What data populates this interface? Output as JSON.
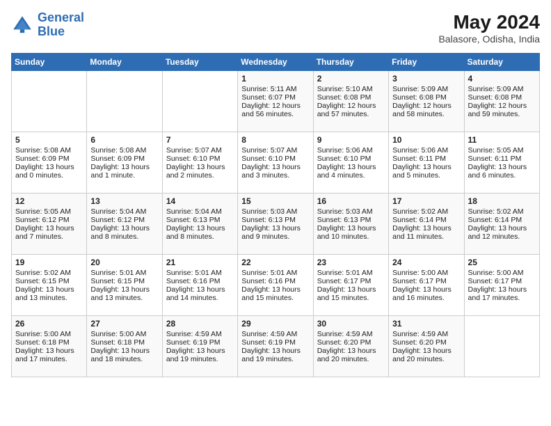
{
  "logo": {
    "line1": "General",
    "line2": "Blue"
  },
  "title": {
    "month_year": "May 2024",
    "location": "Balasore, Odisha, India"
  },
  "days_of_week": [
    "Sunday",
    "Monday",
    "Tuesday",
    "Wednesday",
    "Thursday",
    "Friday",
    "Saturday"
  ],
  "weeks": [
    [
      {
        "day": "",
        "sunrise": "",
        "sunset": "",
        "daylight": ""
      },
      {
        "day": "",
        "sunrise": "",
        "sunset": "",
        "daylight": ""
      },
      {
        "day": "",
        "sunrise": "",
        "sunset": "",
        "daylight": ""
      },
      {
        "day": "1",
        "sunrise": "Sunrise: 5:11 AM",
        "sunset": "Sunset: 6:07 PM",
        "daylight": "Daylight: 12 hours and 56 minutes."
      },
      {
        "day": "2",
        "sunrise": "Sunrise: 5:10 AM",
        "sunset": "Sunset: 6:08 PM",
        "daylight": "Daylight: 12 hours and 57 minutes."
      },
      {
        "day": "3",
        "sunrise": "Sunrise: 5:09 AM",
        "sunset": "Sunset: 6:08 PM",
        "daylight": "Daylight: 12 hours and 58 minutes."
      },
      {
        "day": "4",
        "sunrise": "Sunrise: 5:09 AM",
        "sunset": "Sunset: 6:08 PM",
        "daylight": "Daylight: 12 hours and 59 minutes."
      }
    ],
    [
      {
        "day": "5",
        "sunrise": "Sunrise: 5:08 AM",
        "sunset": "Sunset: 6:09 PM",
        "daylight": "Daylight: 13 hours and 0 minutes."
      },
      {
        "day": "6",
        "sunrise": "Sunrise: 5:08 AM",
        "sunset": "Sunset: 6:09 PM",
        "daylight": "Daylight: 13 hours and 1 minute."
      },
      {
        "day": "7",
        "sunrise": "Sunrise: 5:07 AM",
        "sunset": "Sunset: 6:10 PM",
        "daylight": "Daylight: 13 hours and 2 minutes."
      },
      {
        "day": "8",
        "sunrise": "Sunrise: 5:07 AM",
        "sunset": "Sunset: 6:10 PM",
        "daylight": "Daylight: 13 hours and 3 minutes."
      },
      {
        "day": "9",
        "sunrise": "Sunrise: 5:06 AM",
        "sunset": "Sunset: 6:10 PM",
        "daylight": "Daylight: 13 hours and 4 minutes."
      },
      {
        "day": "10",
        "sunrise": "Sunrise: 5:06 AM",
        "sunset": "Sunset: 6:11 PM",
        "daylight": "Daylight: 13 hours and 5 minutes."
      },
      {
        "day": "11",
        "sunrise": "Sunrise: 5:05 AM",
        "sunset": "Sunset: 6:11 PM",
        "daylight": "Daylight: 13 hours and 6 minutes."
      }
    ],
    [
      {
        "day": "12",
        "sunrise": "Sunrise: 5:05 AM",
        "sunset": "Sunset: 6:12 PM",
        "daylight": "Daylight: 13 hours and 7 minutes."
      },
      {
        "day": "13",
        "sunrise": "Sunrise: 5:04 AM",
        "sunset": "Sunset: 6:12 PM",
        "daylight": "Daylight: 13 hours and 8 minutes."
      },
      {
        "day": "14",
        "sunrise": "Sunrise: 5:04 AM",
        "sunset": "Sunset: 6:13 PM",
        "daylight": "Daylight: 13 hours and 8 minutes."
      },
      {
        "day": "15",
        "sunrise": "Sunrise: 5:03 AM",
        "sunset": "Sunset: 6:13 PM",
        "daylight": "Daylight: 13 hours and 9 minutes."
      },
      {
        "day": "16",
        "sunrise": "Sunrise: 5:03 AM",
        "sunset": "Sunset: 6:13 PM",
        "daylight": "Daylight: 13 hours and 10 minutes."
      },
      {
        "day": "17",
        "sunrise": "Sunrise: 5:02 AM",
        "sunset": "Sunset: 6:14 PM",
        "daylight": "Daylight: 13 hours and 11 minutes."
      },
      {
        "day": "18",
        "sunrise": "Sunrise: 5:02 AM",
        "sunset": "Sunset: 6:14 PM",
        "daylight": "Daylight: 13 hours and 12 minutes."
      }
    ],
    [
      {
        "day": "19",
        "sunrise": "Sunrise: 5:02 AM",
        "sunset": "Sunset: 6:15 PM",
        "daylight": "Daylight: 13 hours and 13 minutes."
      },
      {
        "day": "20",
        "sunrise": "Sunrise: 5:01 AM",
        "sunset": "Sunset: 6:15 PM",
        "daylight": "Daylight: 13 hours and 13 minutes."
      },
      {
        "day": "21",
        "sunrise": "Sunrise: 5:01 AM",
        "sunset": "Sunset: 6:16 PM",
        "daylight": "Daylight: 13 hours and 14 minutes."
      },
      {
        "day": "22",
        "sunrise": "Sunrise: 5:01 AM",
        "sunset": "Sunset: 6:16 PM",
        "daylight": "Daylight: 13 hours and 15 minutes."
      },
      {
        "day": "23",
        "sunrise": "Sunrise: 5:01 AM",
        "sunset": "Sunset: 6:17 PM",
        "daylight": "Daylight: 13 hours and 15 minutes."
      },
      {
        "day": "24",
        "sunrise": "Sunrise: 5:00 AM",
        "sunset": "Sunset: 6:17 PM",
        "daylight": "Daylight: 13 hours and 16 minutes."
      },
      {
        "day": "25",
        "sunrise": "Sunrise: 5:00 AM",
        "sunset": "Sunset: 6:17 PM",
        "daylight": "Daylight: 13 hours and 17 minutes."
      }
    ],
    [
      {
        "day": "26",
        "sunrise": "Sunrise: 5:00 AM",
        "sunset": "Sunset: 6:18 PM",
        "daylight": "Daylight: 13 hours and 17 minutes."
      },
      {
        "day": "27",
        "sunrise": "Sunrise: 5:00 AM",
        "sunset": "Sunset: 6:18 PM",
        "daylight": "Daylight: 13 hours and 18 minutes."
      },
      {
        "day": "28",
        "sunrise": "Sunrise: 4:59 AM",
        "sunset": "Sunset: 6:19 PM",
        "daylight": "Daylight: 13 hours and 19 minutes."
      },
      {
        "day": "29",
        "sunrise": "Sunrise: 4:59 AM",
        "sunset": "Sunset: 6:19 PM",
        "daylight": "Daylight: 13 hours and 19 minutes."
      },
      {
        "day": "30",
        "sunrise": "Sunrise: 4:59 AM",
        "sunset": "Sunset: 6:20 PM",
        "daylight": "Daylight: 13 hours and 20 minutes."
      },
      {
        "day": "31",
        "sunrise": "Sunrise: 4:59 AM",
        "sunset": "Sunset: 6:20 PM",
        "daylight": "Daylight: 13 hours and 20 minutes."
      },
      {
        "day": "",
        "sunrise": "",
        "sunset": "",
        "daylight": ""
      }
    ]
  ]
}
